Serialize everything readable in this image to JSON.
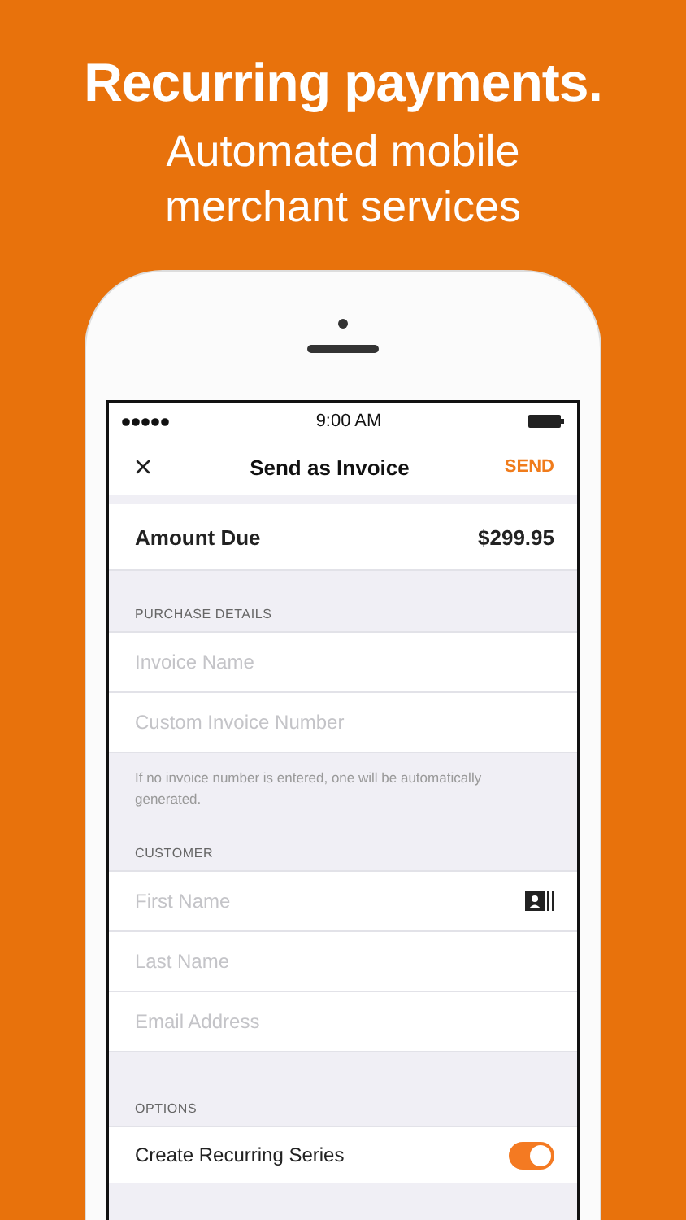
{
  "headline": "Recurring payments.",
  "subtitle": "Automated mobile merchant services",
  "status_bar": {
    "time": "9:00 AM"
  },
  "nav": {
    "title": "Send as Invoice",
    "action": "SEND"
  },
  "amount": {
    "label": "Amount Due",
    "value": "$299.95"
  },
  "sections": [
    {
      "header": "PURCHASE DETAILS",
      "fields": [
        {
          "placeholder": "Invoice Name",
          "kind": "text"
        },
        {
          "placeholder": "Custom Invoice Number",
          "kind": "text"
        }
      ],
      "note": "If no invoice number is entered, one will be automatically generated."
    },
    {
      "header": "CUSTOMER",
      "fields": [
        {
          "placeholder": "First Name",
          "kind": "contact"
        },
        {
          "placeholder": "Last Name",
          "kind": "text"
        },
        {
          "placeholder": "Email Address",
          "kind": "text"
        }
      ]
    }
  ],
  "options": {
    "header": "OPTIONS",
    "items": [
      {
        "label": "Create Recurring Series",
        "on": true
      }
    ]
  }
}
